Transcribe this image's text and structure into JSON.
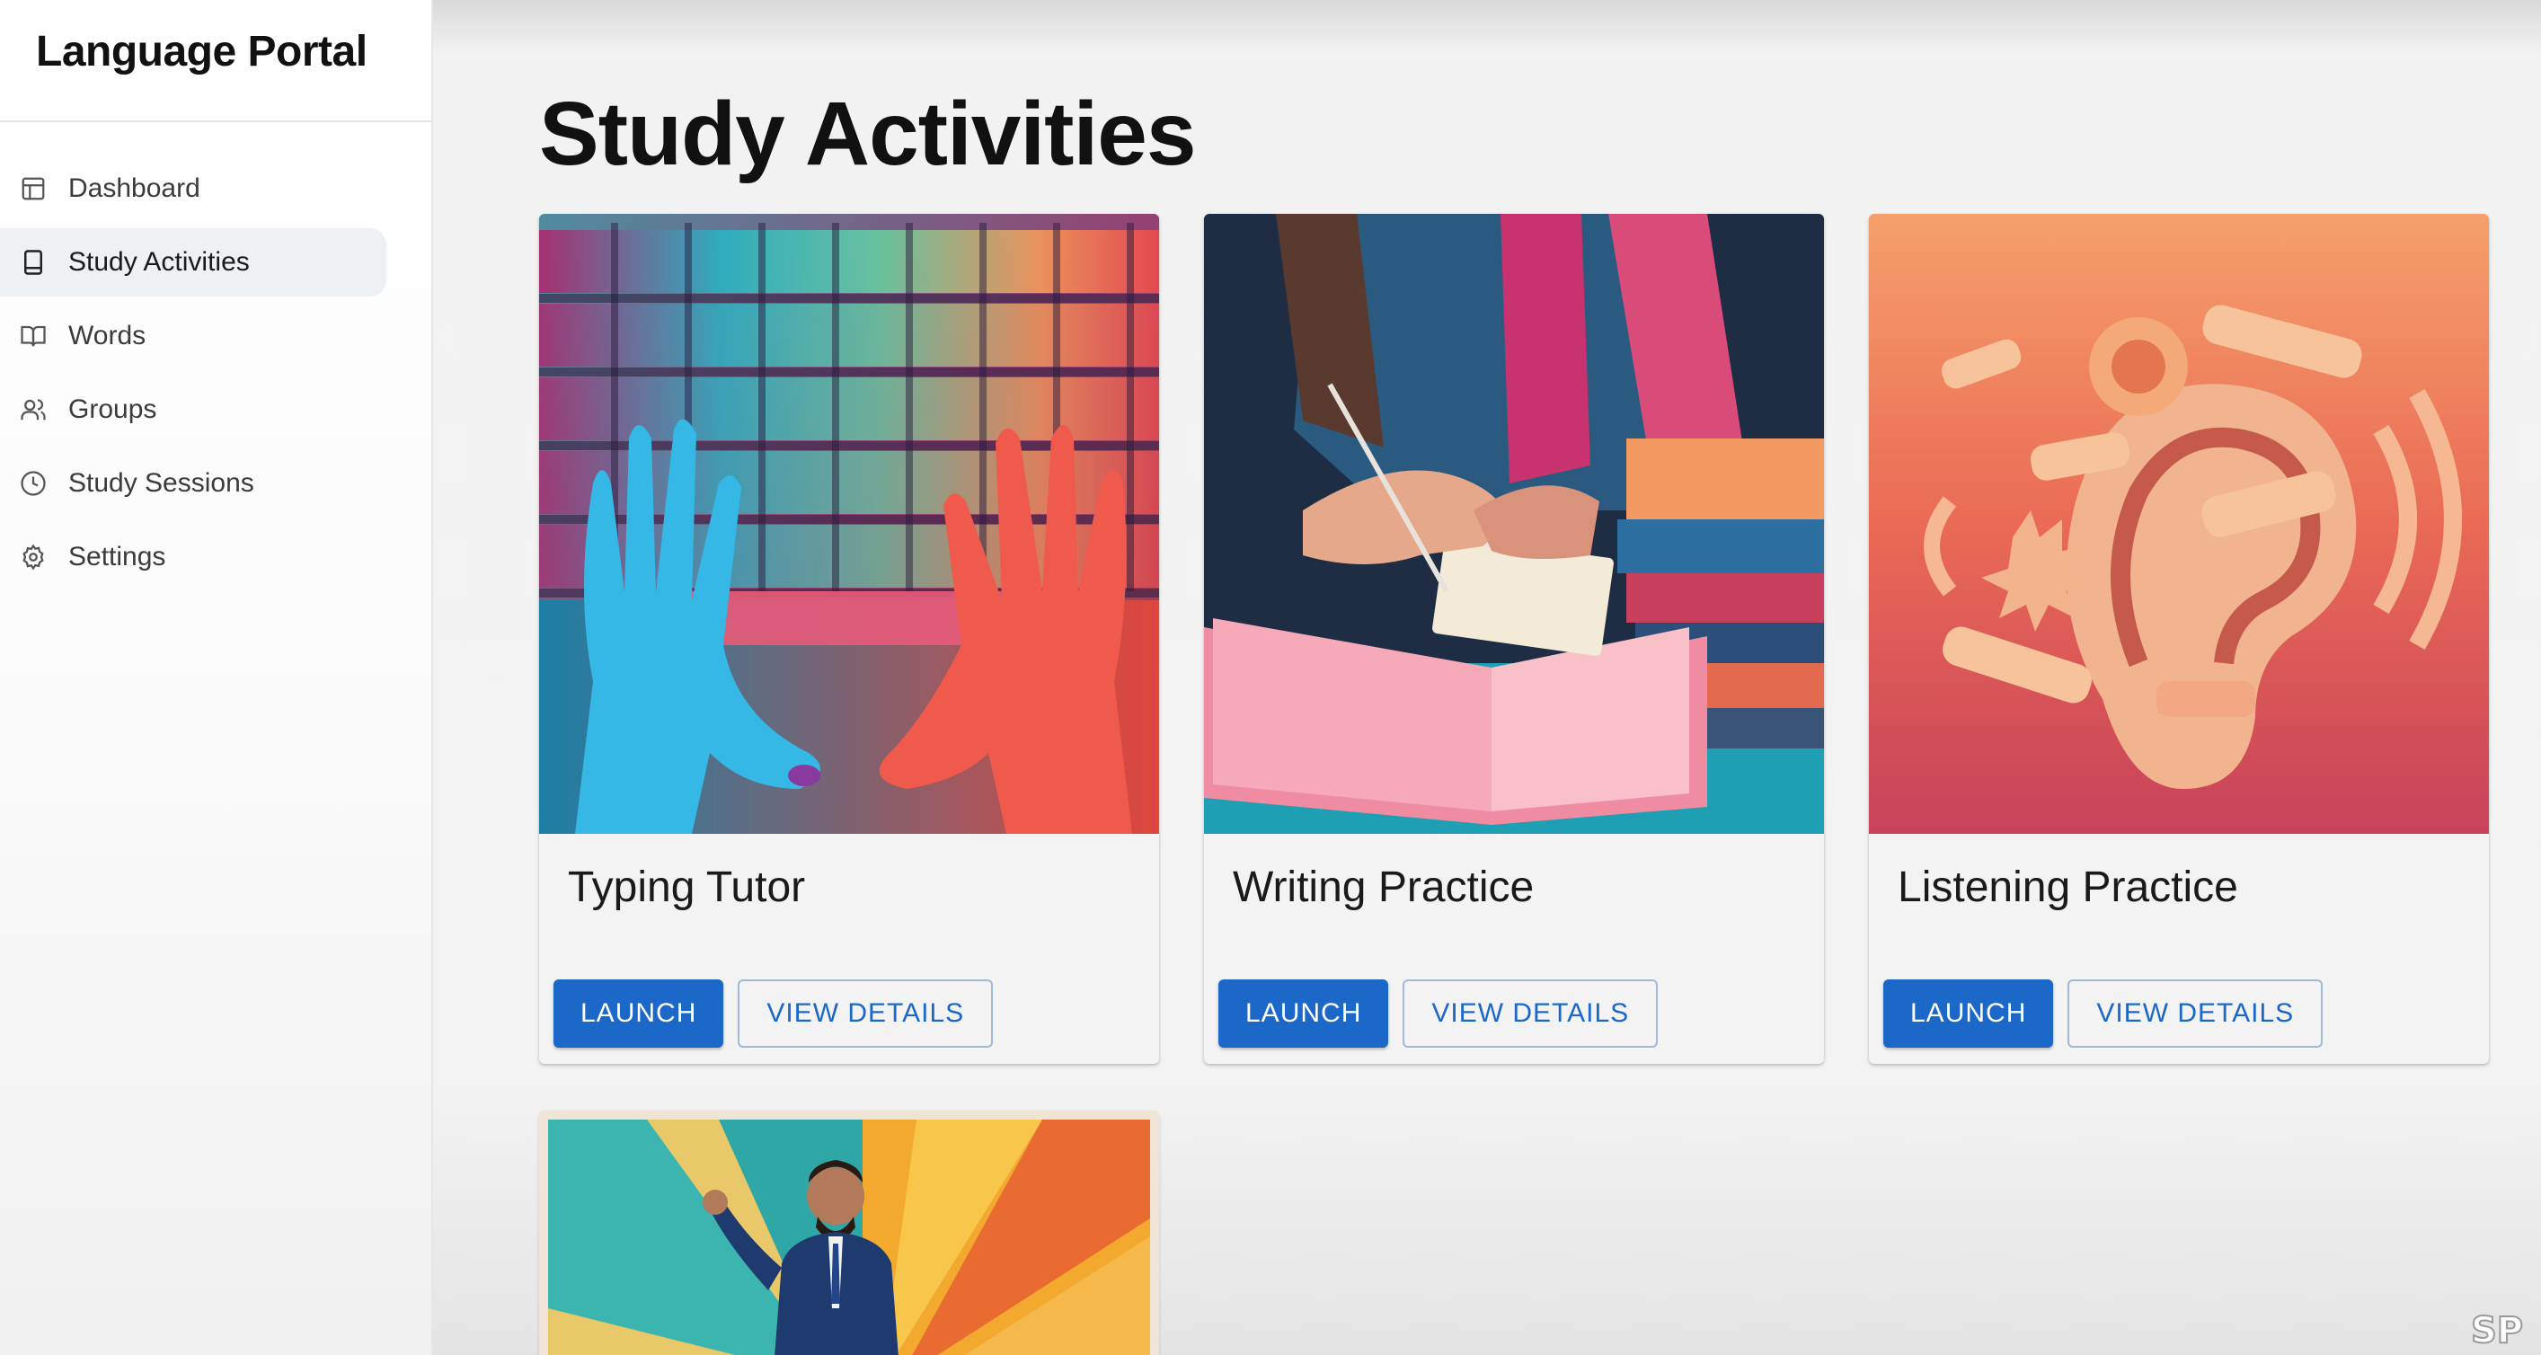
{
  "app": {
    "title": "Language Portal"
  },
  "sidebar": {
    "items": [
      {
        "label": "Dashboard",
        "icon": "layout-icon",
        "active": false
      },
      {
        "label": "Study Activities",
        "icon": "tablet-icon",
        "active": true
      },
      {
        "label": "Words",
        "icon": "book-open-icon",
        "active": false
      },
      {
        "label": "Groups",
        "icon": "users-icon",
        "active": false
      },
      {
        "label": "Study Sessions",
        "icon": "clock-icon",
        "active": false
      },
      {
        "label": "Settings",
        "icon": "gear-icon",
        "active": false
      }
    ]
  },
  "main": {
    "title": "Study Activities",
    "cards": [
      {
        "title": "Typing Tutor",
        "image": "colorful keyboard with hands",
        "launch_label": "LAUNCH",
        "details_label": "VIEW DETAILS"
      },
      {
        "title": "Writing Practice",
        "image": "person writing in notebook beside books",
        "launch_label": "LAUNCH",
        "details_label": "VIEW DETAILS"
      },
      {
        "title": "Listening Practice",
        "image": "ear with sound words",
        "launch_label": "LAUNCH",
        "details_label": "VIEW DETAILS"
      }
    ],
    "partial_card": {
      "image": "man in suit presenting with colorful rays"
    }
  },
  "colors": {
    "primary": "#1b68c9",
    "sidebar_active_bg": "#edf1f4"
  }
}
